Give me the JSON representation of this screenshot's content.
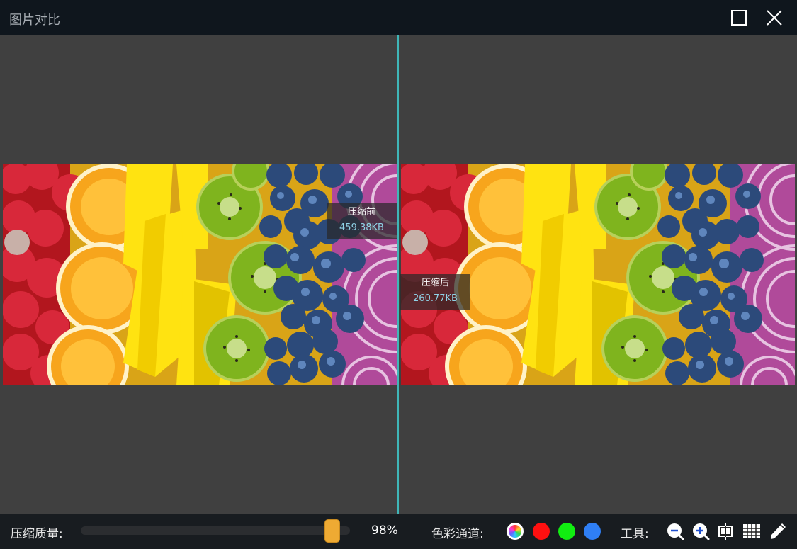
{
  "window": {
    "title": "图片对比"
  },
  "compare": {
    "before_label": "压缩前",
    "before_size": "459.38KB",
    "after_label": "压缩后",
    "after_size": "260.77KB"
  },
  "bottombar": {
    "quality_label": "压缩质量:",
    "quality_value": "98%",
    "quality_percent": 98,
    "channel_label": "色彩通道:",
    "tools_label": "工具:"
  },
  "channels": [
    {
      "name": "all",
      "color": "multicolor"
    },
    {
      "name": "red",
      "color": "#ff1010"
    },
    {
      "name": "green",
      "color": "#11ee11"
    },
    {
      "name": "blue",
      "color": "#2f7ff5"
    }
  ],
  "colors": {
    "divider": "#3fb6b8",
    "slider_handle": "#eeaa33",
    "size_value": "#8fd2e6",
    "titlebar_bg": "#0f161d",
    "viewer_bg": "#404040"
  },
  "tools": [
    "zoom-out-icon",
    "zoom-in-icon",
    "fit-to-window-icon",
    "grid-icon",
    "pencil-icon"
  ]
}
